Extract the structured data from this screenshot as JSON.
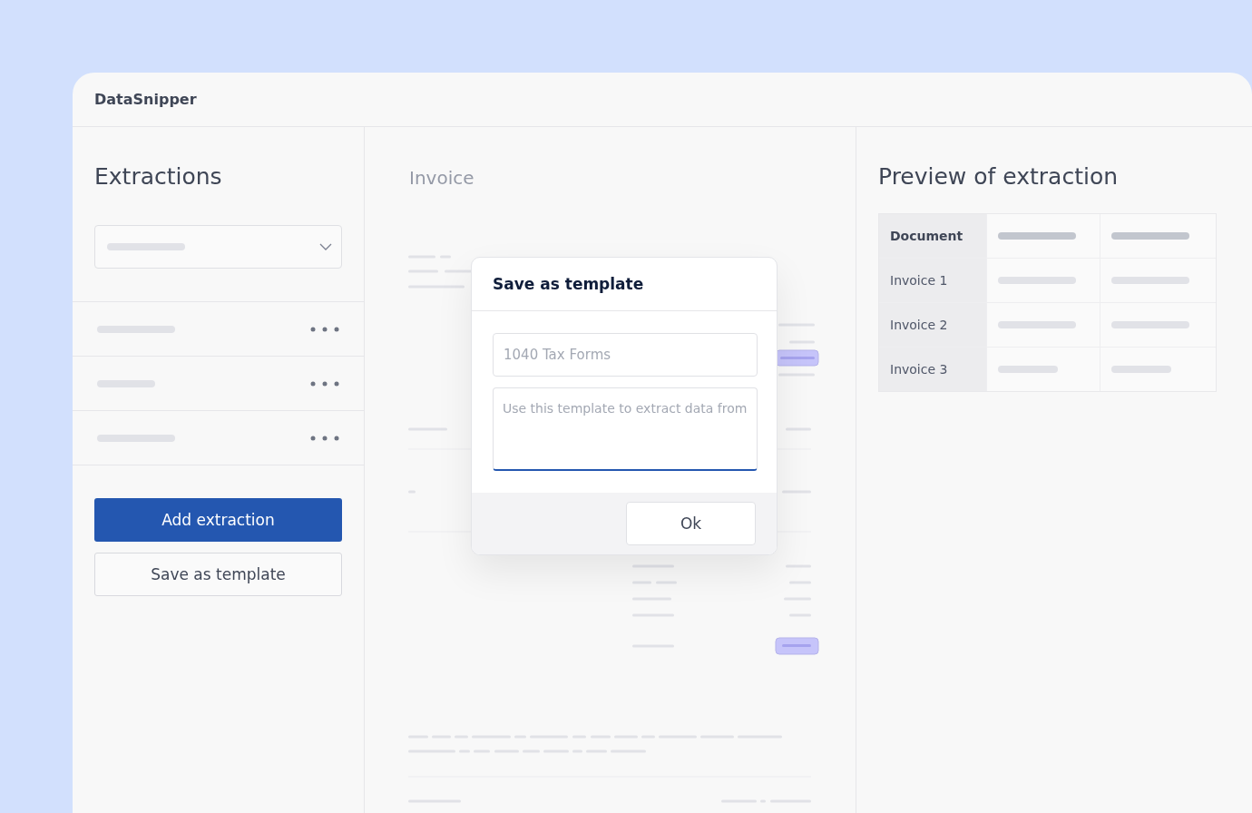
{
  "app": {
    "title": "DataSnipper"
  },
  "extractions": {
    "title": "Extractions",
    "buttons": [
      {
        "label": "Add extraction",
        "kind": "primary"
      },
      {
        "label": "Save as template",
        "kind": "secondary"
      }
    ]
  },
  "document": {
    "title": "Invoice"
  },
  "dialog": {
    "title": "Save as template",
    "name_field": {
      "placeholder": "1040 Tax Forms",
      "focused": false
    },
    "description_field": {
      "placeholder": "Use this template to extract data from",
      "focused": true
    },
    "ok_button": "Ok"
  },
  "preview": {
    "title": "Preview of extraction",
    "header": "Document",
    "rows": [
      "Invoice 1",
      "Invoice 2",
      "Invoice 3"
    ]
  }
}
